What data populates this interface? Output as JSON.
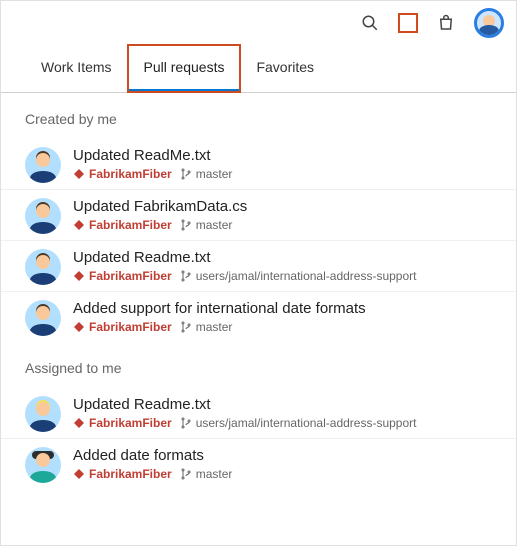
{
  "tabs": [
    {
      "label": "Work Items",
      "active": false
    },
    {
      "label": "Pull requests",
      "active": true,
      "highlight": true
    },
    {
      "label": "Favorites",
      "active": false
    }
  ],
  "sections": [
    {
      "title": "Created by me",
      "items": [
        {
          "avatar": "default",
          "title": "Updated ReadMe.txt",
          "repo": "FabrikamFiber",
          "branch": "master"
        },
        {
          "avatar": "default",
          "title": "Updated FabrikamData.cs",
          "repo": "FabrikamFiber",
          "branch": "master"
        },
        {
          "avatar": "default",
          "title": "Updated Readme.txt",
          "repo": "FabrikamFiber",
          "branch": "users/jamal/international-address-support"
        },
        {
          "avatar": "default",
          "title": "Added support for international date formats",
          "repo": "FabrikamFiber",
          "branch": "master"
        }
      ]
    },
    {
      "title": "Assigned to me",
      "items": [
        {
          "avatar": "blonde",
          "title": "Updated Readme.txt",
          "repo": "FabrikamFiber",
          "branch": "users/jamal/international-address-support"
        },
        {
          "avatar": "teal",
          "title": "Added date formats",
          "repo": "FabrikamFiber",
          "branch": "master"
        }
      ]
    }
  ]
}
